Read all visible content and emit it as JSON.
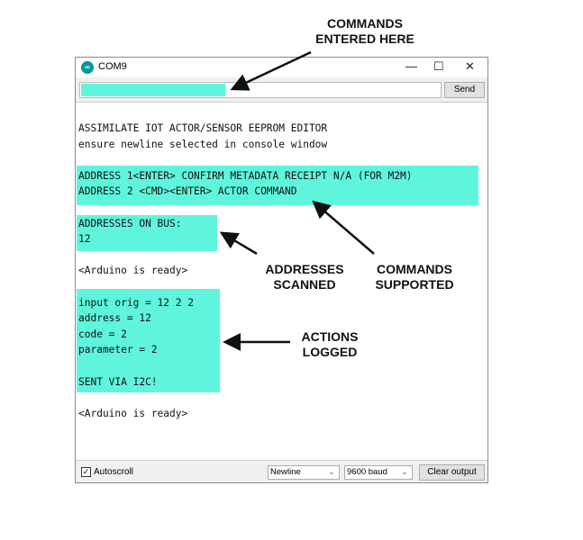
{
  "window": {
    "title": "COM9",
    "minimize": "—",
    "maximize": "☐",
    "close": "✕",
    "logo": "∞"
  },
  "input": {
    "value": "",
    "highlight_color": "#5ef5dc"
  },
  "send_label": "Send",
  "output_lines": [
    "ASSIMILATE IOT ACTOR/SENSOR EEPROM EDITOR",
    "ensure newline selected in console window",
    "",
    "ADDRESS 1<ENTER> CONFIRM METADATA RECEIPT N/A (FOR M2M)",
    "ADDRESS 2 <CMD><ENTER> ACTOR COMMAND",
    "",
    "ADDRESSES ON BUS:",
    "12",
    "",
    "<Arduino is ready>",
    "",
    "input orig = 12 2 2",
    "address = 12",
    "code = 2",
    "parameter = 2",
    "",
    "SENT VIA I2C!",
    "",
    "<Arduino is ready>"
  ],
  "bottom": {
    "autoscroll_label": "Autoscroll",
    "autoscroll_checked": true,
    "line_ending": "Newline",
    "baud": "9600 baud",
    "clear_label": "Clear output"
  },
  "annotations": {
    "commands_entered": [
      "COMMANDS",
      "ENTERED HERE"
    ],
    "addresses_scanned": [
      "ADDRESSES",
      "SCANNED"
    ],
    "commands_supported": [
      "COMMANDS",
      "SUPPORTED"
    ],
    "actions_logged": [
      "ACTIONS",
      "LOGGED"
    ]
  }
}
